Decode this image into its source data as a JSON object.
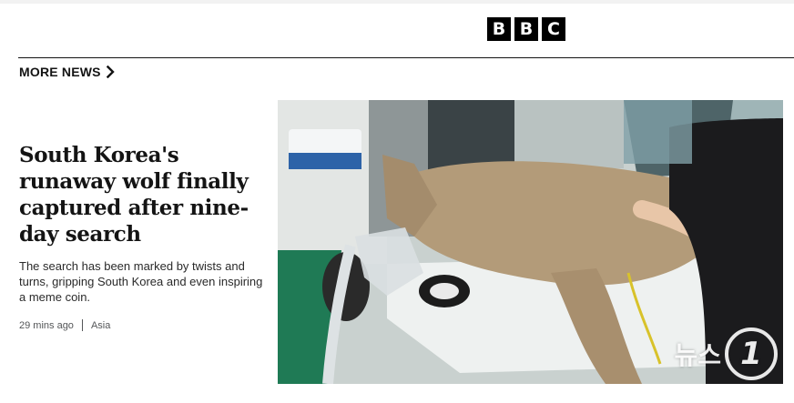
{
  "brand": {
    "logo_letters": [
      "B",
      "B",
      "C"
    ]
  },
  "section": {
    "label": "MORE NEWS",
    "chevron_icon": "chevron-right-icon"
  },
  "article": {
    "headline": "South Korea's runaway wolf finally captured after nine-day search",
    "summary": "The search has been marked by twists and turns, gripping South Korea and even inspiring a meme coin.",
    "time": "29 mins ago",
    "category": "Asia",
    "image_watermark": {
      "text": "뉴스",
      "mark": "1"
    }
  },
  "colors": {
    "text": "#141414",
    "meta": "#545658",
    "logo_bg": "#000000",
    "rule": "#141414"
  }
}
